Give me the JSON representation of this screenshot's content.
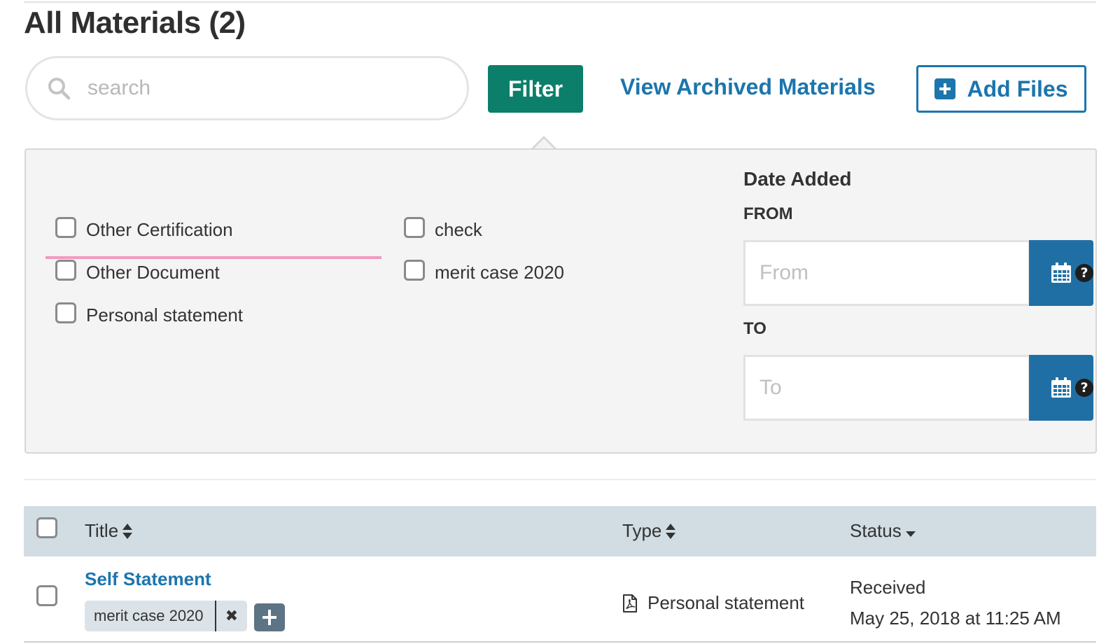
{
  "page": {
    "title": "All Materials (2)"
  },
  "toolbar": {
    "search_placeholder": "search",
    "search_icon": "search-icon",
    "filter_label": "Filter",
    "archived_link": "View Archived Materials",
    "add_files_label": "Add Files",
    "add_files_icon": "plus-square-icon"
  },
  "filters": {
    "types_col1": [
      "Other Certification",
      "Other Document",
      "Personal statement"
    ],
    "types_col2": [
      "check",
      "merit case 2020"
    ],
    "date": {
      "title": "Date Added",
      "from_label": "FROM",
      "from_placeholder": "From",
      "to_label": "TO",
      "to_placeholder": "To",
      "calendar_icon": "calendar-icon",
      "help_icon": "question-circle-icon",
      "accent_color": "#1f6fa5"
    }
  },
  "table": {
    "columns": [
      "Title",
      "Type",
      "Status"
    ],
    "rows": [
      {
        "title": "Self Statement",
        "tags": [
          "merit case 2020"
        ],
        "type": "Personal statement",
        "type_icon": "pdf-file-icon",
        "status": "Received",
        "date": "May 25, 2018 at 11:25 AM"
      }
    ]
  },
  "colors": {
    "primary_link": "#1c75ad",
    "filter_button": "#0b7f6a",
    "table_header": "#d1dde3",
    "highlight_rule": "#f09bc1"
  }
}
